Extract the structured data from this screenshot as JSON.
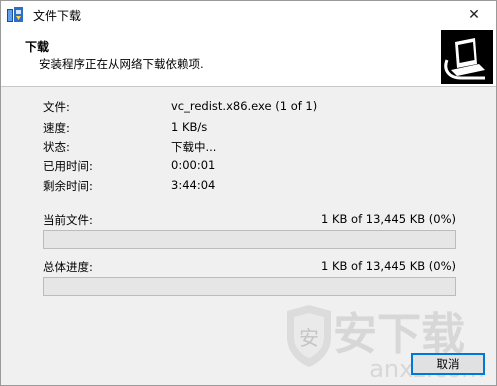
{
  "window": {
    "title": "文件下载",
    "close_glyph": "✕"
  },
  "header": {
    "title": "下载",
    "subtitle": "安装程序正在从网络下载依赖项."
  },
  "info": [
    {
      "label": "文件:",
      "value": "vc_redist.x86.exe (1 of 1)"
    },
    {
      "label": "速度:",
      "value": "1 KB/s"
    },
    {
      "label": "状态:",
      "value": "下载中..."
    },
    {
      "label": "已用时间:",
      "value": "0:00:01"
    },
    {
      "label": "剩余时间:",
      "value": "3:44:04"
    }
  ],
  "current_file": {
    "label": "当前文件:",
    "status": "1 KB of 13,445 KB (0%)",
    "progress": 0
  },
  "total": {
    "label": "总体进度:",
    "status": "1 KB of 13,445 KB (0%)",
    "progress": 0
  },
  "buttons": {
    "cancel": "取消"
  },
  "watermark": {
    "brand": "安下载",
    "domain": "anxz.com"
  },
  "icons": {
    "app": "installer-app-icon",
    "logo": "computer-network-logo-icon",
    "close": "close-icon",
    "watermark": "shield-watermark-icon"
  },
  "colors": {
    "progress_fill": "#06b025",
    "focus_border": "#0078d7"
  }
}
